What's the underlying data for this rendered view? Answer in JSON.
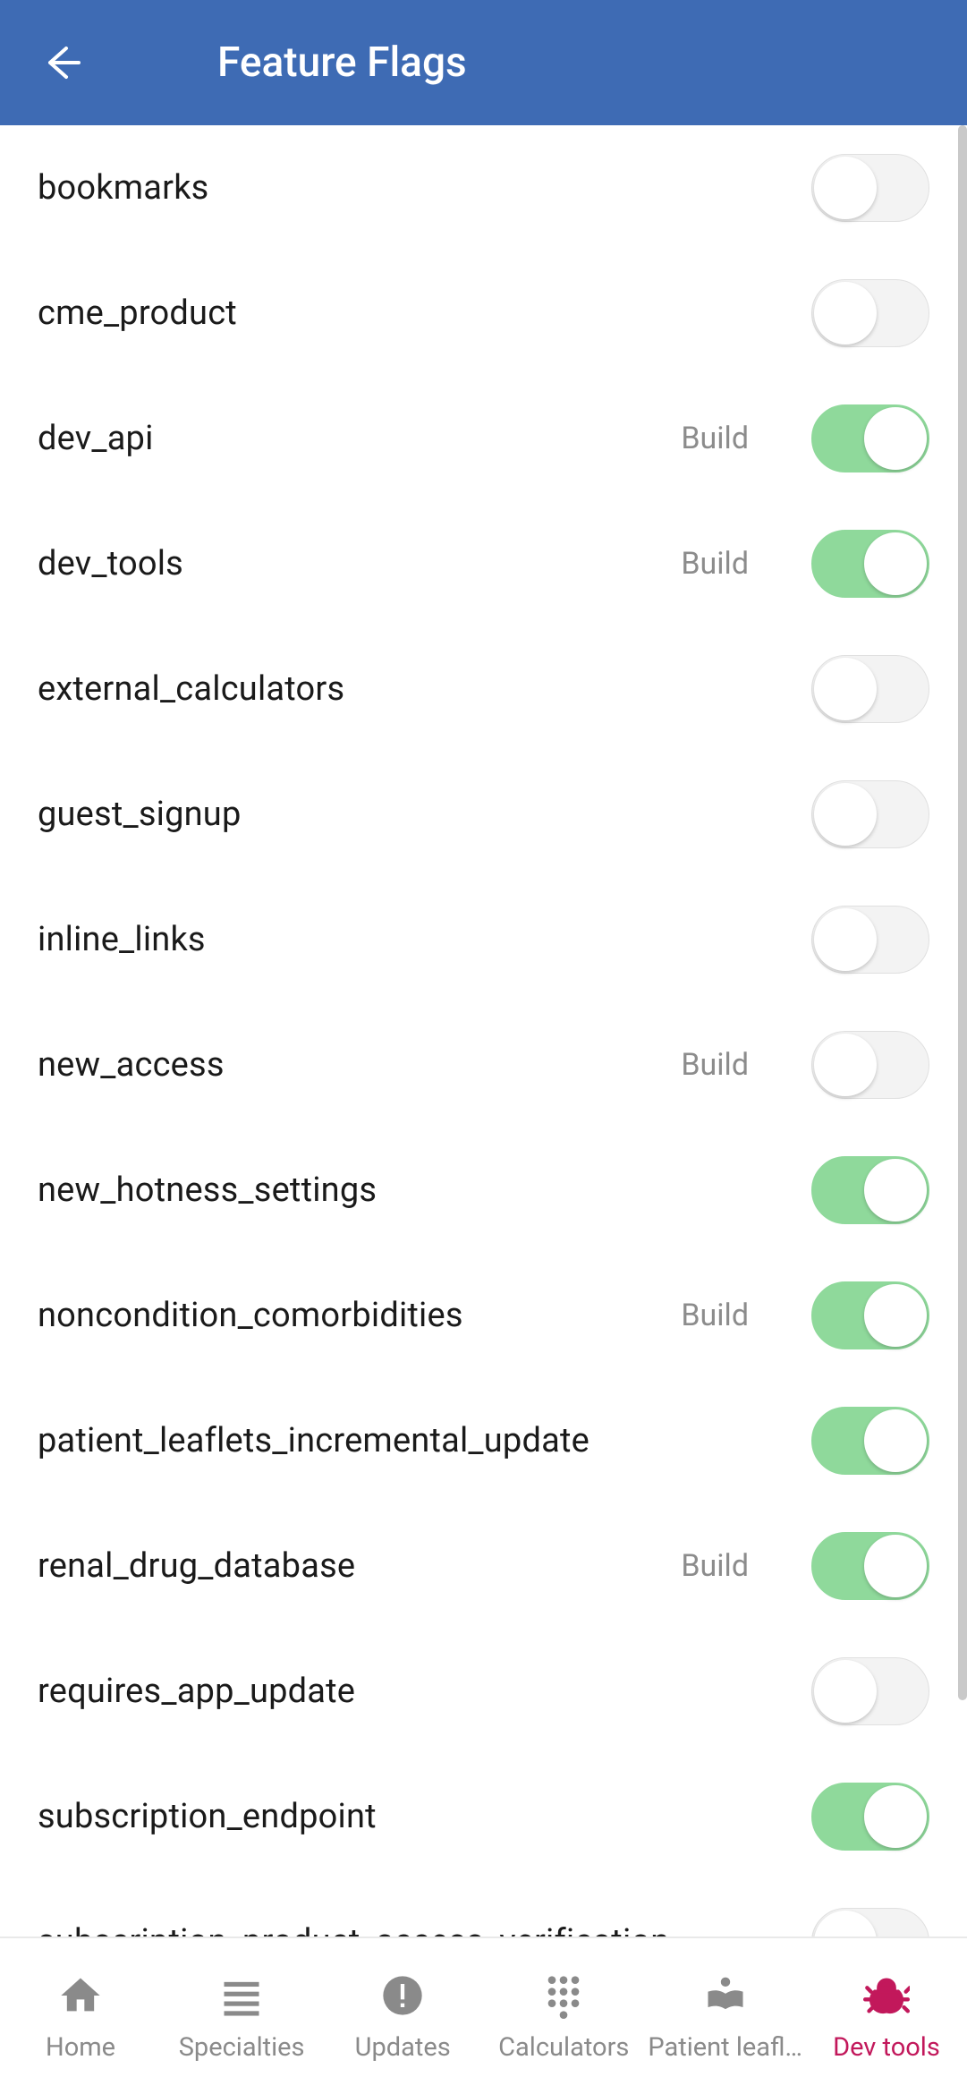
{
  "header": {
    "title": "Feature Flags"
  },
  "flags": [
    {
      "name": "bookmarks",
      "build": "",
      "on": false
    },
    {
      "name": "cme_product",
      "build": "",
      "on": false
    },
    {
      "name": "dev_api",
      "build": "Build",
      "on": true
    },
    {
      "name": "dev_tools",
      "build": "Build",
      "on": true
    },
    {
      "name": "external_calculators",
      "build": "",
      "on": false
    },
    {
      "name": "guest_signup",
      "build": "",
      "on": false
    },
    {
      "name": "inline_links",
      "build": "",
      "on": false
    },
    {
      "name": "new_access",
      "build": "Build",
      "on": false
    },
    {
      "name": "new_hotness_settings",
      "build": "",
      "on": true
    },
    {
      "name": "noncondition_comorbidities",
      "build": "Build",
      "on": true
    },
    {
      "name": "patient_leaflets_incremental_update",
      "build": "",
      "on": true
    },
    {
      "name": "renal_drug_database",
      "build": "Build",
      "on": true
    },
    {
      "name": "requires_app_update",
      "build": "",
      "on": false
    },
    {
      "name": "subscription_endpoint",
      "build": "",
      "on": true
    },
    {
      "name": "subscription_product_access_verification",
      "build": "",
      "on": false
    }
  ],
  "nav": {
    "items": [
      {
        "label": "Home"
      },
      {
        "label": "Specialties"
      },
      {
        "label": "Updates"
      },
      {
        "label": "Calculators"
      },
      {
        "label": "Patient leafl…"
      },
      {
        "label": "Dev tools"
      }
    ],
    "active_index": 5
  }
}
